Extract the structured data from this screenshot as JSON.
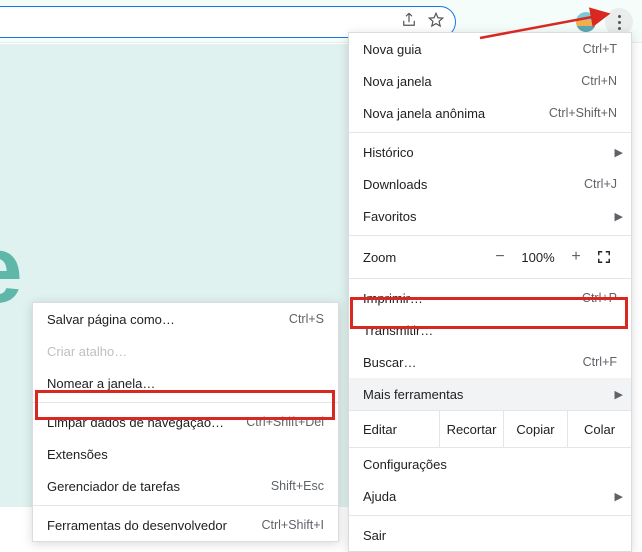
{
  "addressbar": {
    "share_icon": "share",
    "star_icon": "star"
  },
  "gle": "gle",
  "menu": {
    "new_tab": "Nova guia",
    "new_tab_sc": "Ctrl+T",
    "new_window": "Nova janela",
    "new_window_sc": "Ctrl+N",
    "incognito": "Nova janela anônima",
    "incognito_sc": "Ctrl+Shift+N",
    "history": "Histórico",
    "downloads": "Downloads",
    "downloads_sc": "Ctrl+J",
    "bookmarks": "Favoritos",
    "zoom_label": "Zoom",
    "zoom_minus": "−",
    "zoom_value": "100%",
    "zoom_plus": "+",
    "print": "Imprimir…",
    "print_sc": "Ctrl+P",
    "cast": "Transmitir…",
    "find": "Buscar…",
    "find_sc": "Ctrl+F",
    "more_tools": "Mais ferramentas",
    "edit": "Editar",
    "cut": "Recortar",
    "copy": "Copiar",
    "paste": "Colar",
    "settings": "Configurações",
    "help": "Ajuda",
    "exit": "Sair"
  },
  "submenu": {
    "save_as": "Salvar página como…",
    "save_as_sc": "Ctrl+S",
    "shortcut": "Criar atalho…",
    "name_window": "Nomear a janela…",
    "clear_data": "Limpar dados de navegação…",
    "clear_data_sc": "Ctrl+Shift+Del",
    "extensions": "Extensões",
    "task_mgr": "Gerenciador de tarefas",
    "task_mgr_sc": "Shift+Esc",
    "dev_tools": "Ferramentas do desenvolvedor",
    "dev_tools_sc": "Ctrl+Shift+I"
  }
}
